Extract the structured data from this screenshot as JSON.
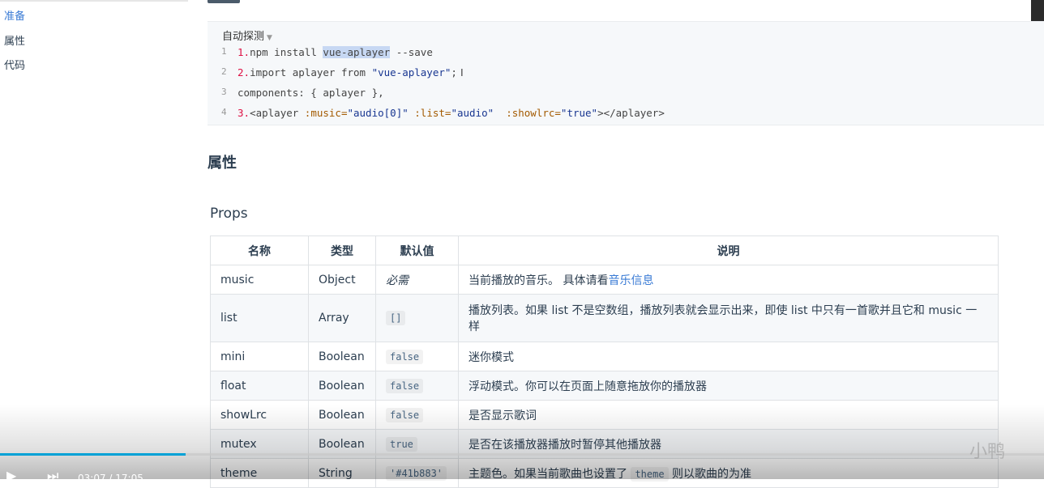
{
  "toc": {
    "items": [
      {
        "label": "准备",
        "active": true
      },
      {
        "label": "属性",
        "active": false
      },
      {
        "label": "代码",
        "active": false
      }
    ]
  },
  "code_block": {
    "title": "自动探测",
    "lines": [
      {
        "n": "1",
        "parts": [
          {
            "t": "1.",
            "c": "num"
          },
          {
            "t": "npm install ",
            "c": ""
          },
          {
            "t": "vue-aplayer",
            "c": "hl"
          },
          {
            "t": " --save",
            "c": ""
          }
        ]
      },
      {
        "n": "2",
        "parts": [
          {
            "t": "2.",
            "c": "num"
          },
          {
            "t": "import aplayer from ",
            "c": ""
          },
          {
            "t": "\"vue-aplayer\"",
            "c": "str"
          },
          {
            "t": ";",
            "c": ""
          }
        ]
      },
      {
        "n": "3",
        "parts": [
          {
            "t": "components: { aplayer },",
            "c": ""
          }
        ]
      },
      {
        "n": "4",
        "parts": [
          {
            "t": "3.",
            "c": "num"
          },
          {
            "t": "<aplayer ",
            "c": ""
          },
          {
            "t": ":music=",
            "c": "str2"
          },
          {
            "t": "\"audio[0]\"",
            "c": "str"
          },
          {
            "t": " ",
            "c": ""
          },
          {
            "t": ":list=",
            "c": "str2"
          },
          {
            "t": "\"audio\"",
            "c": "str"
          },
          {
            "t": "  ",
            "c": ""
          },
          {
            "t": ":showlrc=",
            "c": "str2"
          },
          {
            "t": "\"true\"",
            "c": "str"
          },
          {
            "t": "></aplayer>",
            "c": ""
          }
        ]
      }
    ]
  },
  "section_title": "属性",
  "sub_title": "Props",
  "table": {
    "headers": [
      "名称",
      "类型",
      "默认值",
      "说明"
    ],
    "rows": [
      {
        "name": "music",
        "type": "Object",
        "default": "必需",
        "default_style": "italic",
        "desc": "当前播放的音乐。 具体请看",
        "desc_link": "音乐信息"
      },
      {
        "name": "list",
        "type": "Array",
        "default": "[]",
        "default_style": "code",
        "desc": "播放列表。如果 list 不是空数组，播放列表就会显示出来，即使 list 中只有一首歌并且它和 music 一样",
        "desc_link": ""
      },
      {
        "name": "mini",
        "type": "Boolean",
        "default": "false",
        "default_style": "code",
        "desc": "迷你模式",
        "desc_link": ""
      },
      {
        "name": "float",
        "type": "Boolean",
        "default": "false",
        "default_style": "code",
        "desc": "浮动模式。你可以在页面上随意拖放你的播放器",
        "desc_link": ""
      },
      {
        "name": "showLrc",
        "type": "Boolean",
        "default": "false",
        "default_style": "code",
        "desc": "是否显示歌词",
        "desc_link": ""
      },
      {
        "name": "mutex",
        "type": "Boolean",
        "default": "true",
        "default_style": "code",
        "desc": "是否在该播放器播放时暂停其他播放器",
        "desc_link": ""
      },
      {
        "name": "theme",
        "type": "String",
        "default": "'#41b883'",
        "default_style": "code",
        "desc": "主题色。如果当前歌曲也设置了",
        "desc_code": "theme",
        "desc_after": "则以歌曲的为准",
        "desc_link": ""
      }
    ]
  },
  "video": {
    "progress": 0.178,
    "time": "03:07 / 17:05",
    "accent": "#00a1d6"
  },
  "colors": {
    "link": "#3a7bd5",
    "text": "#2c3e50",
    "code_bg": "#f6f8fa"
  }
}
